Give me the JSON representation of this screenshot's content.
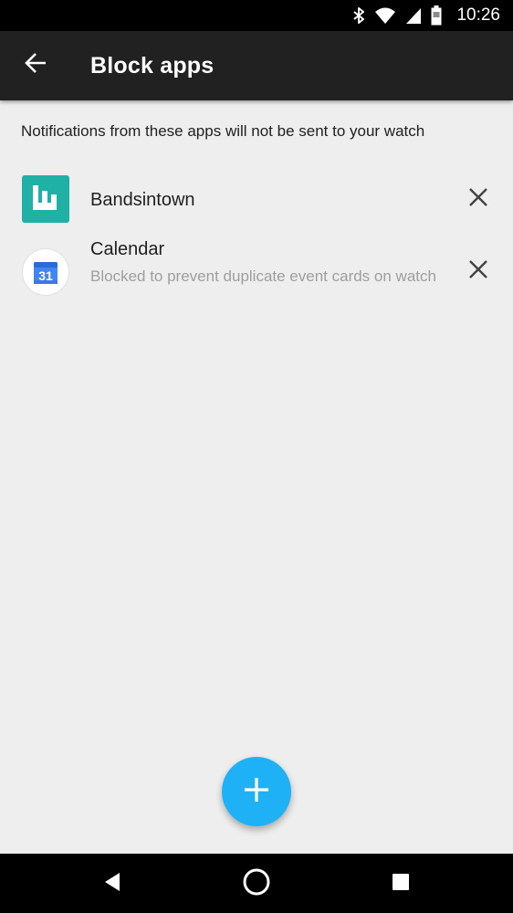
{
  "status_bar": {
    "time": "10:26",
    "icons": [
      "bluetooth-icon",
      "wifi-icon",
      "cell-signal-icon",
      "battery-icon"
    ]
  },
  "app_bar": {
    "title": "Block apps",
    "back_icon": "arrow-back-icon"
  },
  "description": "Notifications from these apps will not be sent to your watch",
  "blocked_apps": [
    {
      "name": "Bandsintown",
      "subtitle": "",
      "icon": "bandsintown-icon",
      "remove_icon": "close-icon"
    },
    {
      "name": "Calendar",
      "subtitle": "Blocked to prevent duplicate event cards on watch",
      "icon": "calendar-icon",
      "icon_text": "31",
      "remove_icon": "close-icon"
    }
  ],
  "fab": {
    "icon": "plus-icon"
  },
  "nav_bar": {
    "icons": [
      "back-triangle-icon",
      "home-circle-icon",
      "recents-square-icon"
    ]
  },
  "colors": {
    "app_bar": "#212121",
    "background": "#eeeeee",
    "fab": "#1eb1f5",
    "bandsintown": "#1fb0a6",
    "calendar_blue": "#4285f4"
  }
}
